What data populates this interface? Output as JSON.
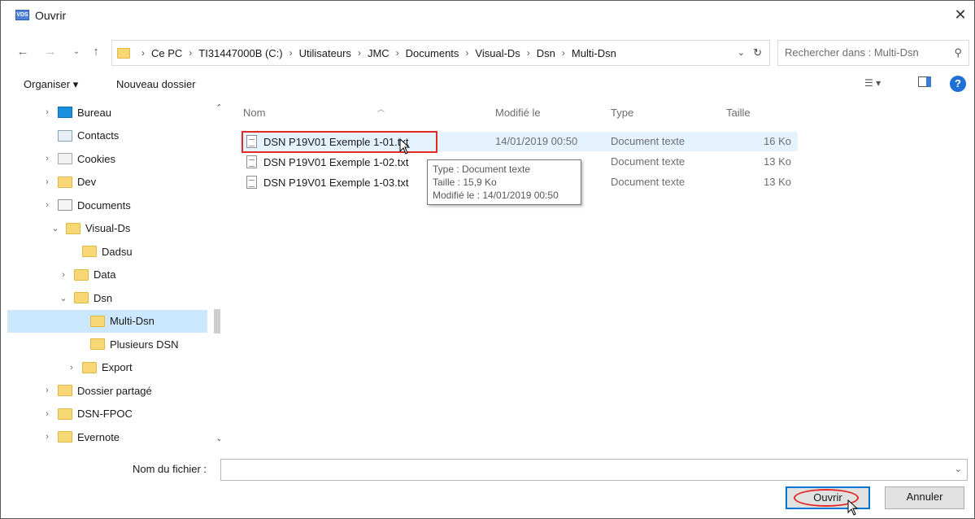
{
  "window": {
    "title": "Ouvrir",
    "app_icon_text": "VDS"
  },
  "address": {
    "crumbs": [
      "Ce PC",
      "TI31447000B (C:)",
      "Utilisateurs",
      "JMC",
      "Documents",
      "Visual-Ds",
      "Dsn",
      "Multi-Dsn"
    ]
  },
  "search": {
    "placeholder": "Rechercher dans : Multi-Dsn"
  },
  "toolbar": {
    "organize_label": "Organiser ▾",
    "new_folder_label": "Nouveau dossier"
  },
  "tree": {
    "items": [
      {
        "label": "Bureau",
        "icon": "desktop-icon",
        "chevron": "›"
      },
      {
        "label": "Contacts",
        "icon": "contacts-icon",
        "chevron": ""
      },
      {
        "label": "Cookies",
        "icon": "cookies-icon",
        "chevron": "›"
      },
      {
        "label": "Dev",
        "icon": "folder-icon",
        "chevron": "›"
      },
      {
        "label": "Documents",
        "icon": "documents-icon",
        "chevron": "›"
      },
      {
        "label": "Visual-Ds",
        "icon": "folder-icon",
        "chevron": "⌄"
      },
      {
        "label": "Dadsu",
        "icon": "folder-icon",
        "chevron": ""
      },
      {
        "label": "Data",
        "icon": "folder-icon",
        "chevron": "›"
      },
      {
        "label": "Dsn",
        "icon": "folder-icon",
        "chevron": "⌄"
      },
      {
        "label": "Multi-Dsn",
        "icon": "folder-icon",
        "chevron": ""
      },
      {
        "label": "Plusieurs DSN",
        "icon": "folder-icon",
        "chevron": ""
      },
      {
        "label": "Export",
        "icon": "folder-icon",
        "chevron": "›"
      },
      {
        "label": "Dossier partagé",
        "icon": "folder-icon",
        "chevron": "›"
      },
      {
        "label": "DSN-FPOC",
        "icon": "folder-icon",
        "chevron": "›"
      },
      {
        "label": "Evernote",
        "icon": "folder-icon",
        "chevron": "›"
      }
    ]
  },
  "columns": {
    "name": "Nom",
    "modified": "Modifié le",
    "type": "Type",
    "size": "Taille"
  },
  "files": [
    {
      "name": "DSN P19V01 Exemple 1-01.txt",
      "modified": "14/01/2019 00:50",
      "type": "Document texte",
      "size": "16 Ko"
    },
    {
      "name": "DSN P19V01 Exemple 1-02.txt",
      "modified": "",
      "type": "Document texte",
      "size": "13 Ko"
    },
    {
      "name": "DSN P19V01 Exemple 1-03.txt",
      "modified": "",
      "type": "Document texte",
      "size": "13 Ko"
    }
  ],
  "tooltip": {
    "line1": "Type : Document texte",
    "line2": "Taille : 15,9 Ko",
    "line3": "Modifié le : 14/01/2019 00:50"
  },
  "footer": {
    "filename_label": "Nom du fichier :",
    "filename_value": "",
    "open_label": "Ouvrir",
    "cancel_label": "Annuler"
  },
  "colors": {
    "accent": "#0078d7",
    "highlight": "#e32a2a",
    "selection": "#cce8ff"
  }
}
